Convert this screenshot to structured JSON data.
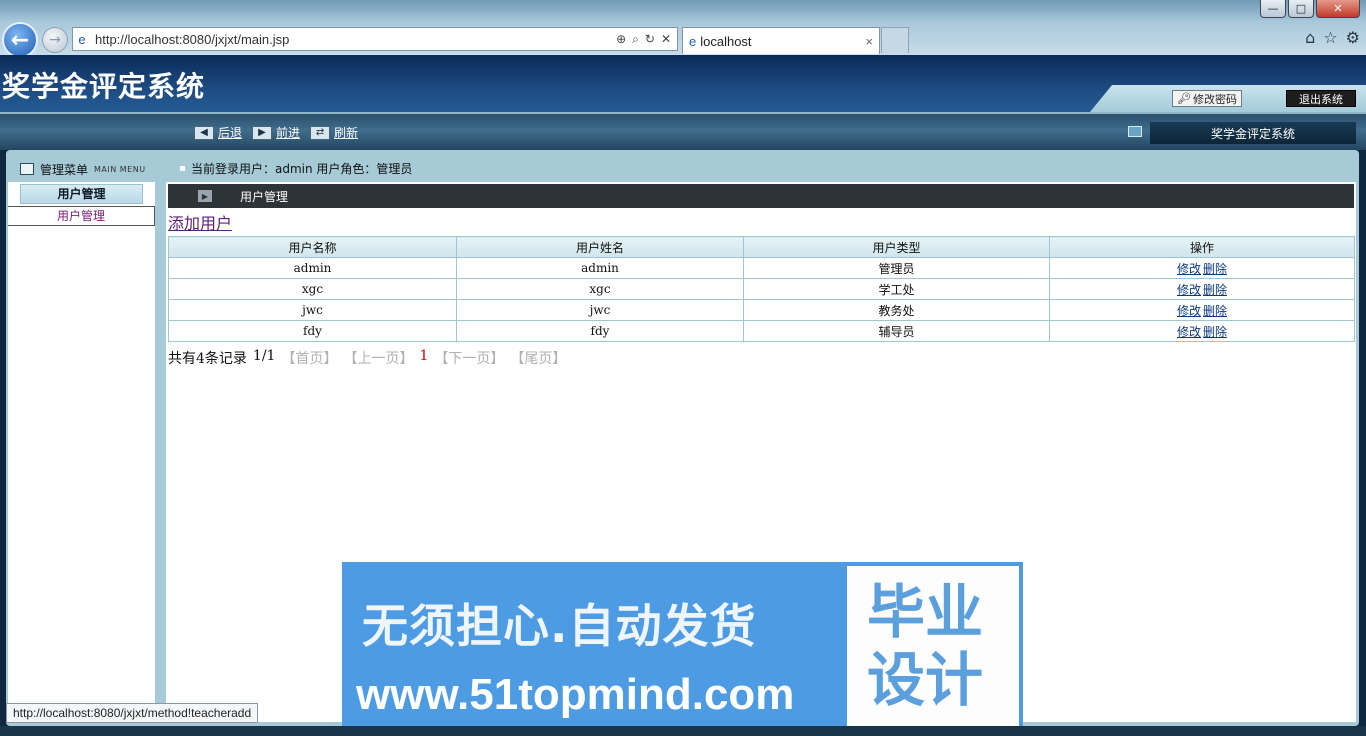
{
  "browser": {
    "url": "http://localhost:8080/jxjxt/main.jsp",
    "tab_title": "localhost",
    "tab_close": "×",
    "window_buttons": {
      "minimize": "—",
      "maximize": "□",
      "close": "✕"
    },
    "icons": [
      "back-arrow-icon",
      "forward-arrow-icon",
      "home-icon",
      "star-icon",
      "gear-icon"
    ]
  },
  "app": {
    "title": "奖学金评定系统",
    "change_password": "修改密码",
    "logout": "退出系统"
  },
  "toolbar": {
    "back": "后退",
    "forward": "前进",
    "refresh": "刷新",
    "system_label": "奖学金评定系统"
  },
  "sidebar": {
    "title": "管理菜单",
    "subtitle": "MAIN MENU",
    "group": "用户管理",
    "item": "用户管理"
  },
  "user_info": "当前登录用户：admin 用户角色：管理员",
  "content": {
    "title": "用户管理",
    "add_link": "添加用户",
    "columns": [
      "用户名称",
      "用户姓名",
      "用户类型",
      "操作"
    ],
    "rows": [
      {
        "username": "admin",
        "name": "admin",
        "type": "管理员",
        "edit": "修改",
        "delete": "删除"
      },
      {
        "username": "xgc",
        "name": "xgc",
        "type": "学工处",
        "edit": "修改",
        "delete": "删除"
      },
      {
        "username": "jwc",
        "name": "jwc",
        "type": "教务处",
        "edit": "修改",
        "delete": "删除"
      },
      {
        "username": "fdy",
        "name": "fdy",
        "type": "辅导员",
        "edit": "修改",
        "delete": "删除"
      }
    ],
    "pager": {
      "total": "共有4条记录",
      "page": "1/1",
      "first": "【首页】",
      "prev": "【上一页】",
      "current": "1",
      "next": "【下一页】",
      "last": "【尾页】"
    }
  },
  "status_url": "http://localhost:8080/jxjxt/method!teacheradd",
  "banner": {
    "line1": "无须担心.自动发货",
    "line2": "www.51topmind.com",
    "right1": "毕业",
    "right2": "设计"
  }
}
